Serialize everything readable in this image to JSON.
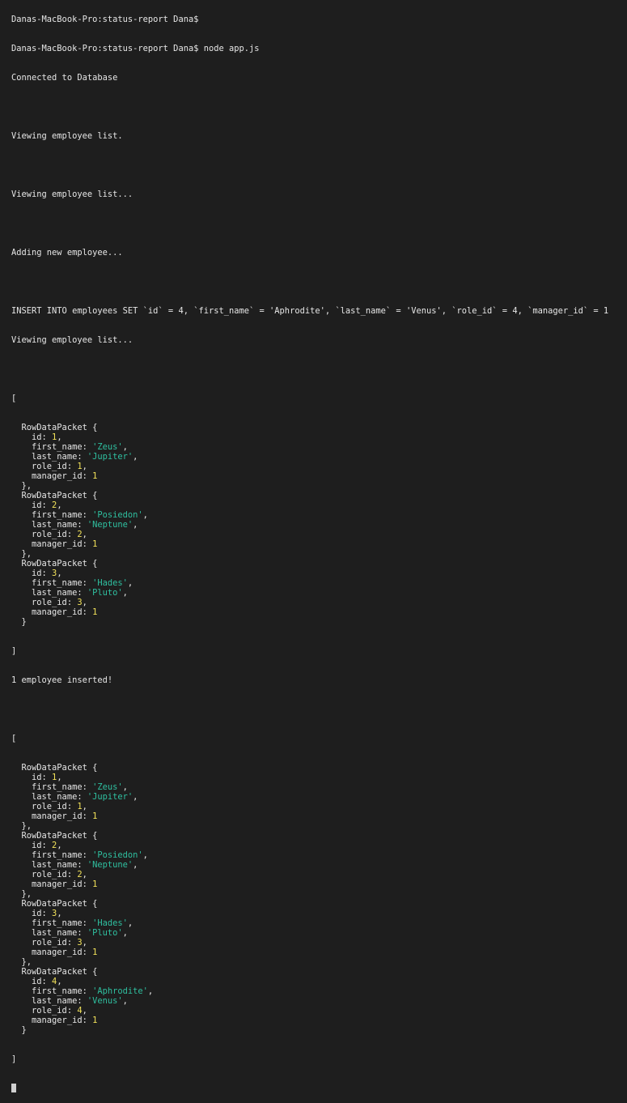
{
  "terminal": {
    "partial_top_line": "Danas-MacBook-Pro:status-report Dana$",
    "prompt_line": "Danas-MacBook-Pro:status-report Dana$ node app.js",
    "messages": {
      "connected": "Connected to Database",
      "viewing_1": "Viewing employee list.",
      "viewing_2": "Viewing employee list...",
      "adding": "Adding new employee...",
      "sql": "INSERT INTO employees SET `id` = 4, `first_name` = 'Aphrodite', `last_name` = 'Venus', `role_id` = 4, `manager_id` = 1",
      "viewing_3": "Viewing employee list...",
      "inserted": "1 employee inserted!"
    },
    "syntax": {
      "open_bracket": "[",
      "close_bracket": "]",
      "packet_name": "RowDataPacket {",
      "close_brace": "}",
      "close_brace_comma": "},",
      "key_id": "id",
      "key_first_name": "first_name",
      "key_last_name": "last_name",
      "key_role_id": "role_id",
      "key_manager_id": "manager_id"
    },
    "colors": {
      "number": "#f2e25a",
      "string": "#2fc0a0",
      "text": "#e6e6e6",
      "background": "#1e1e1e"
    },
    "first_list": [
      {
        "id": "1",
        "first_name": "'Zeus'",
        "last_name": "'Jupiter'",
        "role_id": "1",
        "manager_id": "1"
      },
      {
        "id": "2",
        "first_name": "'Posiedon'",
        "last_name": "'Neptune'",
        "role_id": "2",
        "manager_id": "1"
      },
      {
        "id": "3",
        "first_name": "'Hades'",
        "last_name": "'Pluto'",
        "role_id": "3",
        "manager_id": "1"
      }
    ],
    "second_list": [
      {
        "id": "1",
        "first_name": "'Zeus'",
        "last_name": "'Jupiter'",
        "role_id": "1",
        "manager_id": "1"
      },
      {
        "id": "2",
        "first_name": "'Posiedon'",
        "last_name": "'Neptune'",
        "role_id": "2",
        "manager_id": "1"
      },
      {
        "id": "3",
        "first_name": "'Hades'",
        "last_name": "'Pluto'",
        "role_id": "3",
        "manager_id": "1"
      },
      {
        "id": "4",
        "first_name": "'Aphrodite'",
        "last_name": "'Venus'",
        "role_id": "4",
        "manager_id": "1"
      }
    ]
  }
}
